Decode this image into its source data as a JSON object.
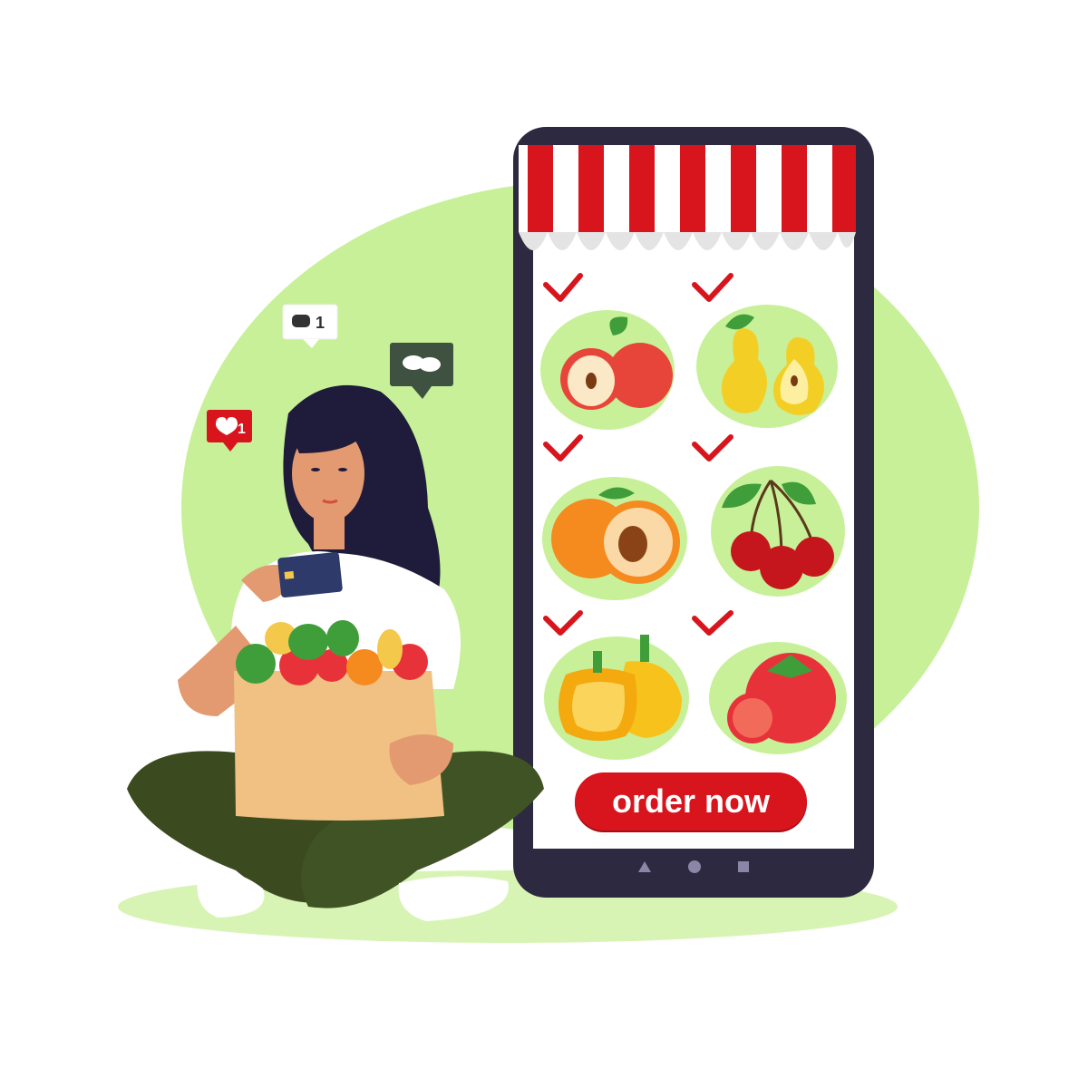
{
  "phone": {
    "order_button_label": "order now"
  },
  "notifications": {
    "comment_count": "1",
    "like_count": "1"
  },
  "colors": {
    "background_blob": "#c8f099",
    "phone_frame": "#2d2940",
    "awning_red": "#d8141d",
    "check_red": "#d8141d",
    "pants": "#3b4a1f",
    "hair": "#1f1b3a"
  },
  "products": [
    {
      "name": "apple",
      "checked": true
    },
    {
      "name": "pear",
      "checked": true
    },
    {
      "name": "peach",
      "checked": true
    },
    {
      "name": "cherry",
      "checked": true
    },
    {
      "name": "bell-pepper",
      "checked": true
    },
    {
      "name": "tomato",
      "checked": true
    }
  ]
}
